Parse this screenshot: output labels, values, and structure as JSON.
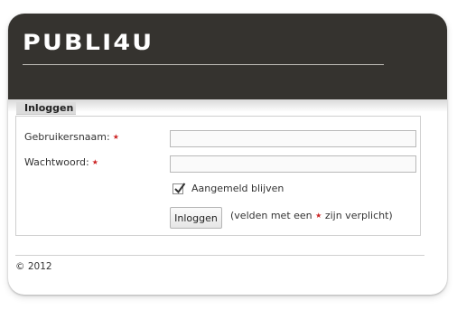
{
  "brand": {
    "logo_text": "PUBLI4U"
  },
  "login": {
    "tab_label": "Inloggen",
    "username_label": "Gebruikersnaam:",
    "password_label": "Wachtwoord:",
    "required_mark": "★",
    "username_value": "",
    "password_value": "",
    "remember_label": "Aangemeld blijven",
    "remember_checked": true,
    "submit_label": "Inloggen",
    "hint_prefix": "(velden met een",
    "hint_suffix": "zijn verplicht)"
  },
  "footer": {
    "copyright": "© 2012"
  },
  "colors": {
    "header_bg": "#35332f",
    "required": "#cc2222"
  }
}
